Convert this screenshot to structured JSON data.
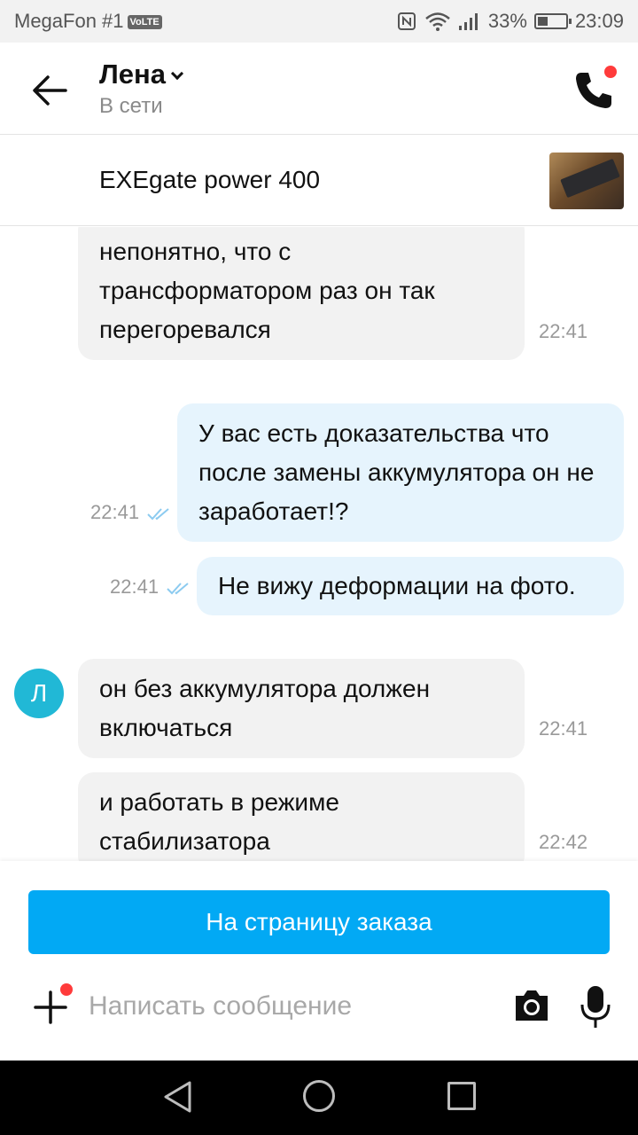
{
  "status_bar": {
    "carrier": "MegaFon #1",
    "volte": "VoLTE",
    "battery": "33%",
    "time": "23:09"
  },
  "header": {
    "contact_name": "Лена",
    "presence": "В сети"
  },
  "item": {
    "title": "EXEgate power 400"
  },
  "messages": [
    {
      "direction": "in",
      "text": "непонятно, что с трансформатором раз он так перегоревался",
      "time": "22:41"
    },
    {
      "direction": "out",
      "text": "У вас есть доказательства что после замены аккумулятора он не заработает!?",
      "time": "22:41"
    },
    {
      "direction": "out",
      "text": "Не вижу деформации на фото.",
      "time": "22:41"
    },
    {
      "direction": "in",
      "text": "он без аккумулятора должен включаться",
      "time": "22:41"
    },
    {
      "direction": "in",
      "text": "и работать в режиме стабилизатора",
      "time": "22:42"
    }
  ],
  "avatar_letter": "Л",
  "bottom": {
    "order_button": "На страницу заказа",
    "input_placeholder": "Написать сообщение"
  },
  "colors": {
    "accent": "#02a9f4",
    "avatar": "#21b8d6",
    "outgoing_bubble": "#e6f4fd",
    "incoming_bubble": "#f2f2f2",
    "notification_dot": "#ff3b3b"
  },
  "icons": [
    "back-arrow-icon",
    "chevron-down-icon",
    "phone-icon",
    "plus-icon",
    "camera-icon",
    "microphone-icon",
    "double-check-icon",
    "nav-back-icon",
    "nav-home-icon",
    "nav-recents-icon"
  ]
}
